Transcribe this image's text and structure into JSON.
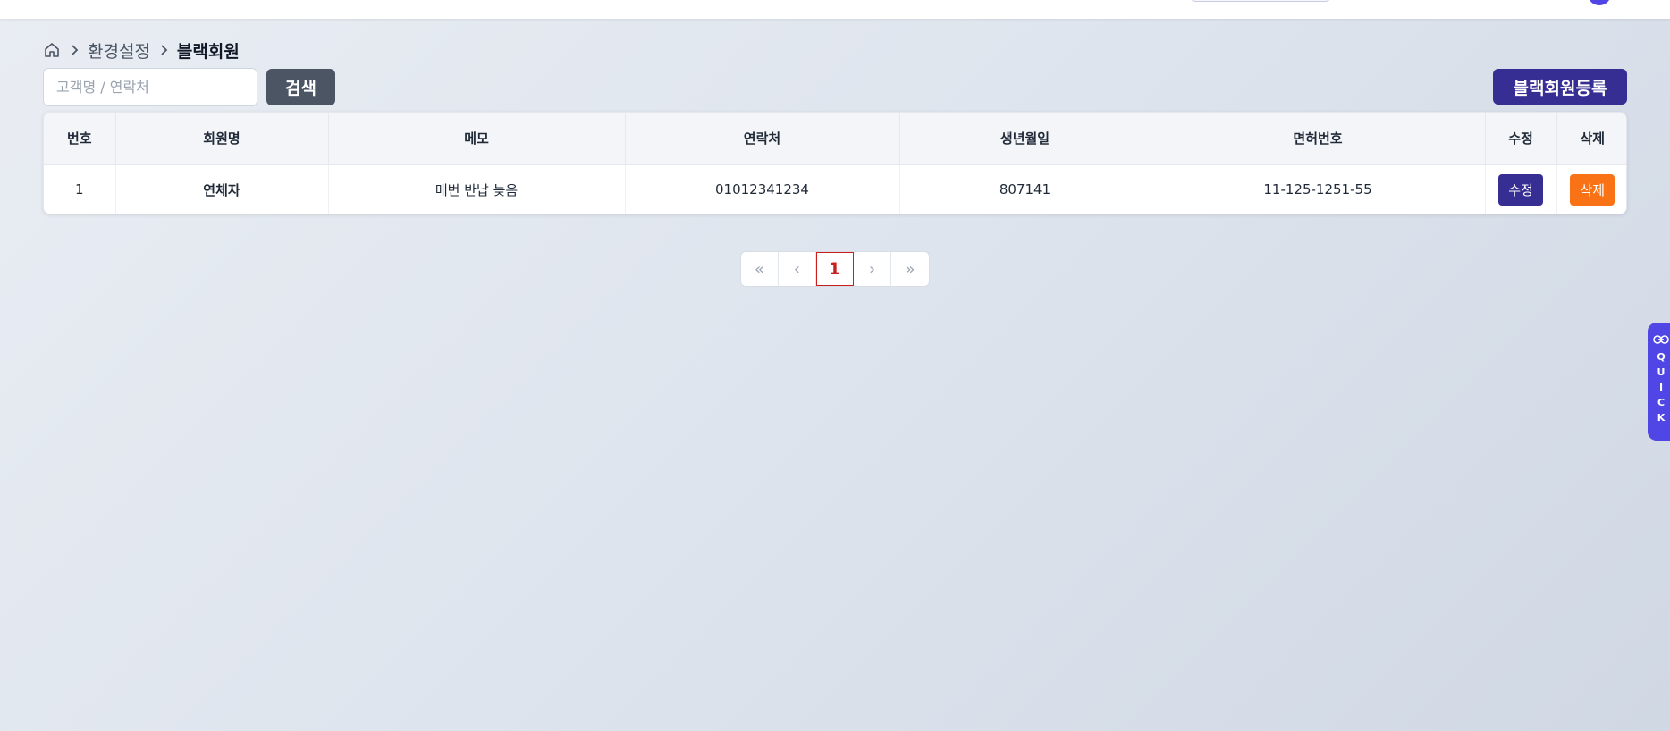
{
  "breadcrumb": {
    "level1": "환경설정",
    "current": "블랙회원"
  },
  "search": {
    "placeholder": "고객명 / 연락처",
    "value": "",
    "button_label": "검색"
  },
  "register_button_label": "블랙회원등록",
  "table": {
    "headers": [
      "번호",
      "회원명",
      "메모",
      "연락처",
      "생년월일",
      "면허번호",
      "수정",
      "삭제"
    ],
    "rows": [
      {
        "no": "1",
        "name": "연체자",
        "memo": "매번 반납 늦음",
        "phone": "01012341234",
        "birth": "807141",
        "license": "11-125-1251-55",
        "edit_label": "수정",
        "delete_label": "삭제"
      }
    ]
  },
  "pagination": {
    "first": "«",
    "prev": "‹",
    "current_page": "1",
    "next": "›",
    "last": "»"
  },
  "quick_tab": {
    "letters": [
      "Q",
      "U",
      "I",
      "C",
      "K"
    ]
  },
  "icons": {
    "home": "home-icon",
    "separator": "chevron-right-icon",
    "quick": "link-icon"
  },
  "colors": {
    "primary": "#372e94",
    "delete": "#f97316",
    "search_button": "#4b5563",
    "quick_tab": "#4f46e5",
    "active_page": "#c81e1e"
  }
}
